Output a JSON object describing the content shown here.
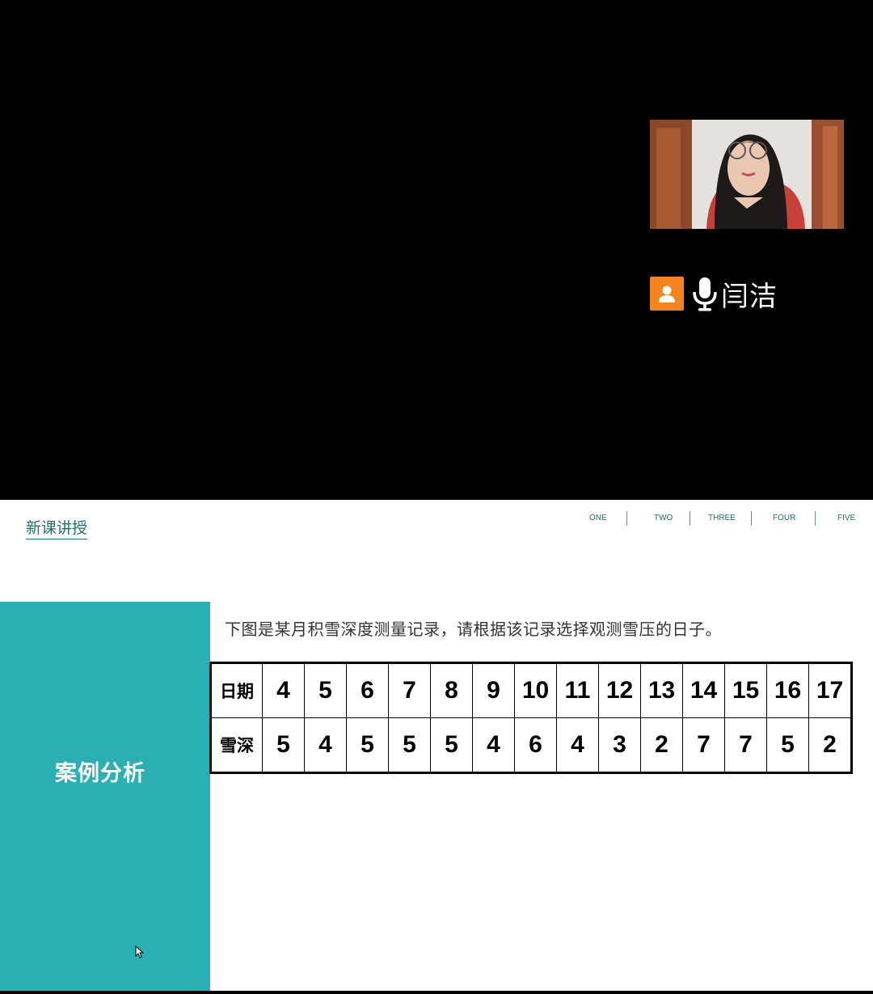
{
  "meeting": {
    "participant_name": "闫洁",
    "avatar_color": "#f5831f"
  },
  "slide": {
    "section_label": "新课讲授",
    "nav_items": [
      "ONE",
      "TWO",
      "THREE",
      "FOUR",
      "FIVE"
    ],
    "panel_title": "案例分析",
    "panel_color": "#2aafb3",
    "question": "下图是某月积雪深度测量记录，请根据该记录选择观测雪压的日子。",
    "table": {
      "row1_header": "日期",
      "row2_header": "雪深",
      "dates": [
        "4",
        "5",
        "6",
        "7",
        "8",
        "9",
        "10",
        "11",
        "12",
        "13",
        "14",
        "15",
        "16",
        "17"
      ],
      "depths": [
        "5",
        "4",
        "5",
        "5",
        "5",
        "4",
        "6",
        "4",
        "3",
        "2",
        "7",
        "7",
        "5",
        "2"
      ]
    }
  }
}
